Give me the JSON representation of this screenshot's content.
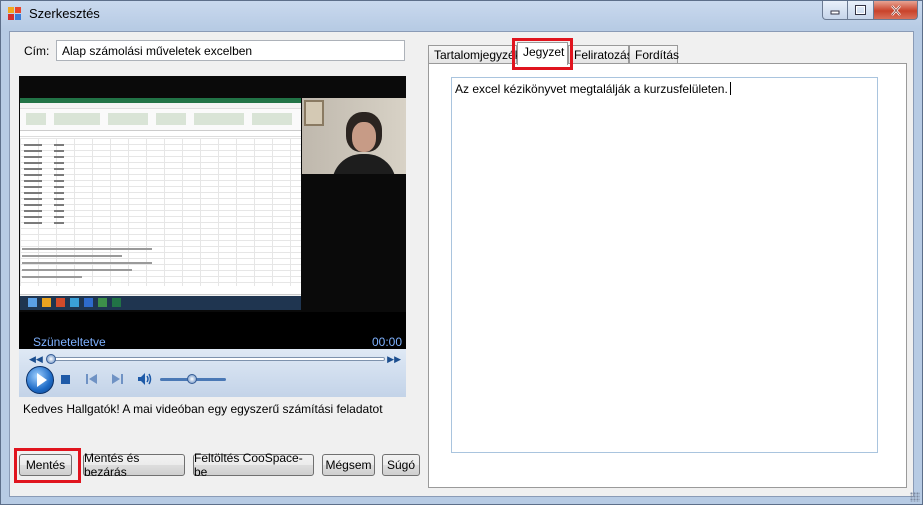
{
  "window": {
    "title": "Szerkesztés",
    "accent": "#e0141e"
  },
  "form": {
    "title_label": "Cím:",
    "title_value": "Alap számolási műveletek excelben"
  },
  "player": {
    "status": "Szüneteltetve",
    "time": "00:00",
    "icons": [
      "seek-back-icon",
      "seek-forward-icon",
      "play-icon",
      "stop-icon",
      "previous-icon",
      "next-icon",
      "volume-icon"
    ]
  },
  "caption_text": "Kedves Hallgatók! A mai videóban egy egyszerű számítási feladatot",
  "buttons": {
    "save": "Mentés",
    "save_close": "Mentés és bezárás",
    "upload": "Feltöltés CooSpace-be",
    "cancel": "Mégsem",
    "help": "Súgó"
  },
  "tabs": [
    {
      "label": "Tartalomjegyzék",
      "active": false
    },
    {
      "label": "Jegyzet",
      "active": true
    },
    {
      "label": "Feliratozás",
      "active": false
    },
    {
      "label": "Fordítás",
      "active": false
    }
  ],
  "note": {
    "text": "Az excel kézikönyvet megtalálják a kurzusfelületen."
  }
}
